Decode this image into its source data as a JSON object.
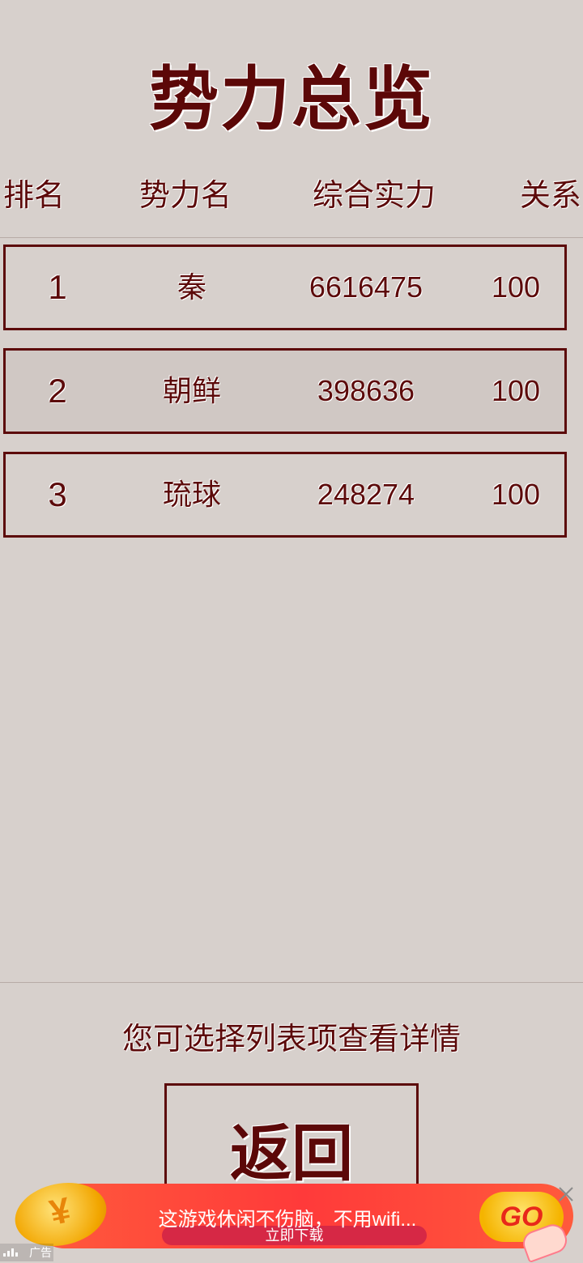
{
  "title": "势力总览",
  "table": {
    "headers": [
      "排名",
      "势力名",
      "综合实力",
      "关系"
    ],
    "rows": [
      {
        "rank": "1",
        "name": "秦",
        "power": "6616475",
        "relation": "100"
      },
      {
        "rank": "2",
        "name": "朝鲜",
        "power": "398636",
        "relation": "100"
      },
      {
        "rank": "3",
        "name": "琉球",
        "power": "248274",
        "relation": "100"
      }
    ]
  },
  "hint": "您可选择列表项查看详情",
  "back_label": "返回",
  "ad": {
    "text": "这游戏休闲不伤脑，不用wifi...",
    "download_label": "立即下载",
    "go_label": "GO",
    "ad_label": "广告",
    "icons": [
      "coin-icon",
      "hand-icon",
      "close-icon"
    ]
  },
  "colors": {
    "background": "#d7d0cc",
    "text": "#5c0a0a",
    "row_border": "#5c0a0a",
    "ad_red": "#ff3a3a",
    "go_yellow": "#f5b400"
  }
}
